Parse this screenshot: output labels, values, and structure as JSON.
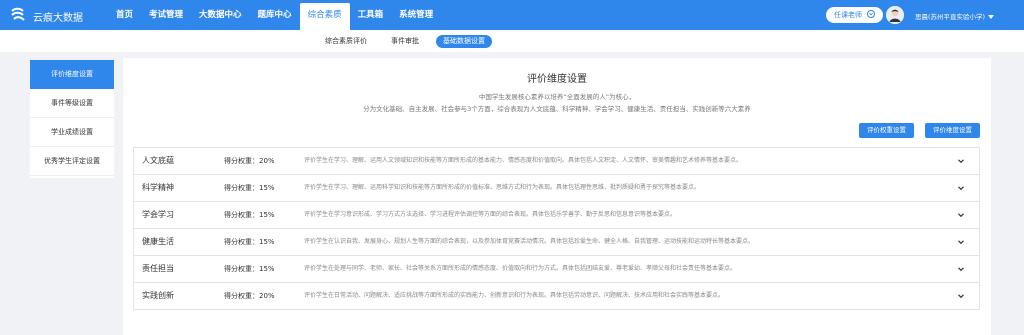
{
  "app": {
    "brand": "云痕大数据"
  },
  "nav": {
    "items": [
      "首页",
      "考试管理",
      "大数据中心",
      "题库中心",
      "综合素质",
      "工具箱",
      "系统管理"
    ],
    "active_index": 4
  },
  "header": {
    "role": "任课老师",
    "user": "思晨(苏州平直实验小学)"
  },
  "subnav": {
    "items": [
      "综合素质评价",
      "事件审批",
      "基础数据设置"
    ],
    "active_index": 2
  },
  "sidebar": {
    "items": [
      "评价维度设置",
      "事件等级设置",
      "学业成绩设置",
      "优秀学生评定设置"
    ],
    "active_index": 0
  },
  "main": {
    "title": "评价维度设置",
    "intro_line1": "中国学生发展核心素养以培养“全面发展的人”为核心，",
    "intro_line2": "分为文化基础、自主发展、社会参与3个方面，综合表现为人文底蕴、科学精神、学会学习、健康生活、责任担当、实践创新等六大素养",
    "weight_button": "评价权重设置",
    "dimension_button": "评价维度设置",
    "dimensions": [
      {
        "name": "人文底蕴",
        "weight": "得分权重：20%",
        "desc": "评价学生在学习、理解、运用人文领域知识和技能等方面所形成的基本能力、情感态度和价值取向。具体包括人文积淀、人文情怀、审美情趣和艺术修养等基本要点。"
      },
      {
        "name": "科学精神",
        "weight": "得分权重：15%",
        "desc": "评价学生在学习、理解、运用科学知识和技能等方面所形成的价值标准、思维方式和行为表现。具体包括理性思维、批判质疑和勇于探究等基本要点。"
      },
      {
        "name": "学会学习",
        "weight": "得分权重：15%",
        "desc": "评价学生在学习意识形成、学习方式方法选择、学习进程评估调控等方面的综合表现。具体包括乐学善学、勤于反思和信息意识等基本要点。"
      },
      {
        "name": "健康生活",
        "weight": "得分权重：15%",
        "desc": "评价学生在认识自我、发展身心、规划人生等方面的综合表现，以及参加体育竞赛活动情况。具体包括珍爱生命、健全人格、自我管理、运动技能和运动特长等基本要点。"
      },
      {
        "name": "责任担当",
        "weight": "得分权重：15%",
        "desc": "评价学生在处理与同学、老师、家长、社会等关系方面所形成的情感态度、价值取向和行为方式。具体包括团结友爱、尊老爱幼、孝顺父母和社会责任等基本要点。"
      },
      {
        "name": "实践创新",
        "weight": "得分权重：20%",
        "desc": "评价学生在日常活动、问题解决、适应挑战等方面所形成的实践能力、创新意识和行为表现。具体包括劳动意识、问题解决、技术应用和社会实践等基本要点。"
      }
    ]
  },
  "colors": {
    "primary": "#2f86eb",
    "background": "#f0f2f5"
  },
  "icons": {
    "logo": "logo-icon",
    "role_chevron": "chevron-down-icon",
    "user_caret": "caret-down-icon",
    "row_expand": "chevron-down-icon"
  }
}
